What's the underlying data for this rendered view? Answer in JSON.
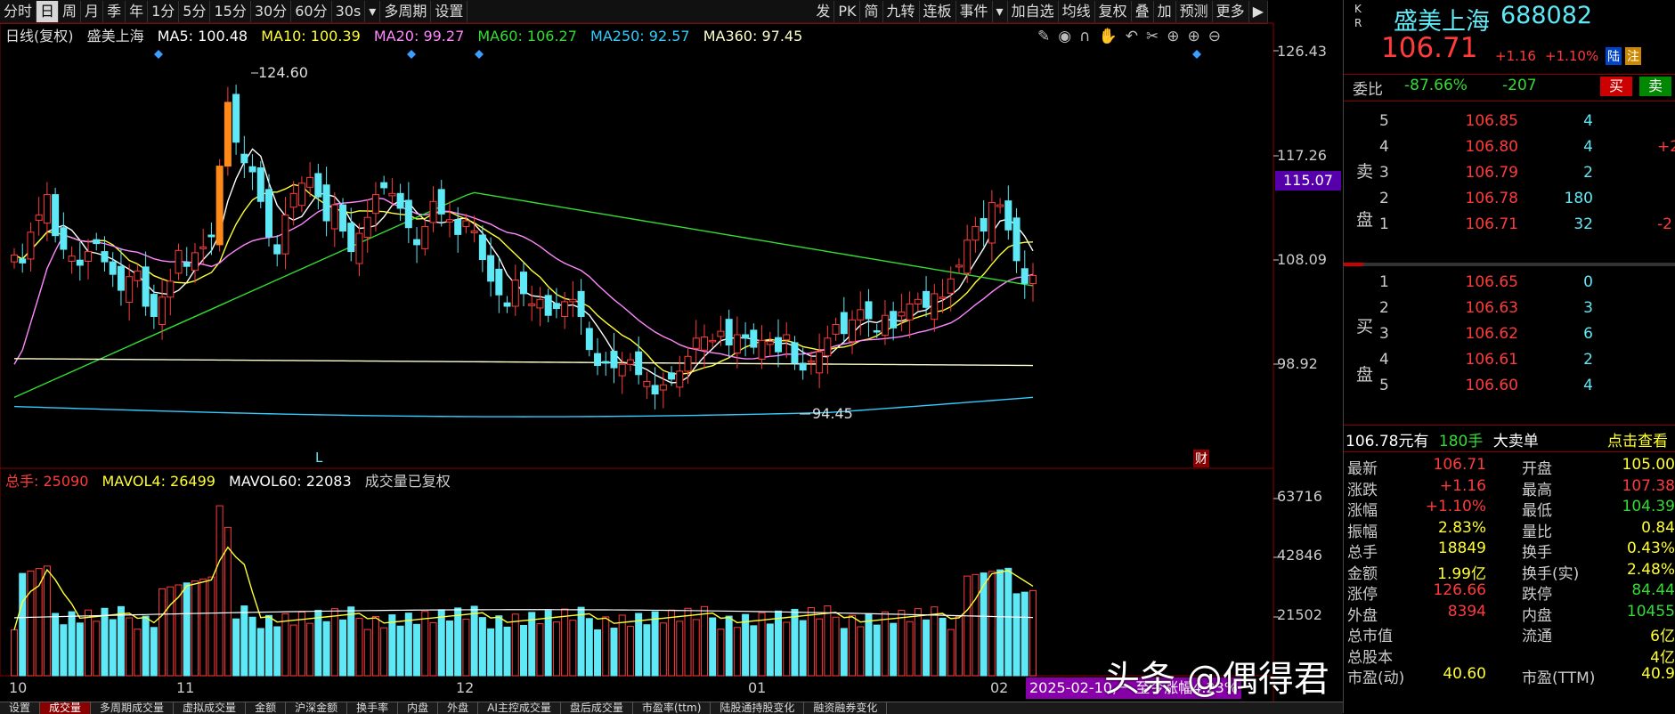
{
  "toolbar": {
    "left_items": [
      "分时",
      "日",
      "周",
      "月",
      "季",
      "年",
      "1分",
      "5分",
      "15分",
      "30分",
      "60分",
      "30s",
      "▾",
      "多周期",
      "设置"
    ],
    "active": "日",
    "right_items": [
      "发",
      "PK",
      "简",
      "九转",
      "连板",
      "事件",
      "▾",
      "加自选",
      "均线",
      "复权",
      "叠",
      "加",
      "预测",
      "更多",
      "▶"
    ]
  },
  "indicators": {
    "period": "日线(复权)",
    "stock": "盛美上海",
    "ma5": "MA5: 100.48",
    "ma10": "MA10: 100.39",
    "ma20": "MA20: 99.27",
    "ma60": "MA60: 106.27",
    "ma250": "MA250: 92.57",
    "ma360": "MA360: 97.45"
  },
  "price_axis": {
    "labels": [
      "126.43",
      "117.26",
      "108.09",
      "98.92"
    ],
    "current": "115.07"
  },
  "annotations": {
    "high": "124.60",
    "low": "94.45",
    "l_mark": "L",
    "cai_mark": "财"
  },
  "volume_indicators": {
    "total": "总手: 25090",
    "mavol4": "MAVOL4: 26499",
    "mavol60": "MAVOL60: 22083",
    "note": "成交量已复权"
  },
  "volume_axis": [
    "63716",
    "42846",
    "21502"
  ],
  "months": [
    "10",
    "11",
    "12",
    "01",
    "02"
  ],
  "range_info": "2025-02-10,一 至今涨幅4.23%",
  "bottom_tabs": [
    "设置",
    "成交量",
    "多周期成交量",
    "虚拟成交量",
    "金额",
    "沪深金额",
    "换手率",
    "内盘",
    "外盘",
    "AI主控成交量",
    "盘后成交量",
    "市盈率(ttm)",
    "陆股通持股变化",
    "融资融券变化"
  ],
  "bottom_active": "成交量",
  "quote": {
    "side_letters": [
      "K",
      "R"
    ],
    "name": "盛美上海",
    "code": "688082",
    "price": "106.71",
    "change": "+1.16",
    "pct": "+1.10%",
    "tags": [
      "陆",
      "注"
    ],
    "weibi_label": "委比",
    "weibi": "-87.66%",
    "weicha": "-207",
    "buy_btn": "买",
    "sell_btn": "卖",
    "sell_label": [
      "卖",
      "盘"
    ],
    "buy_label": [
      "买",
      "盘"
    ],
    "asks": [
      {
        "lvl": "5",
        "price": "106.85",
        "vol": "4",
        "extra": ""
      },
      {
        "lvl": "4",
        "price": "106.80",
        "vol": "4",
        "extra": "+2"
      },
      {
        "lvl": "3",
        "price": "106.79",
        "vol": "2",
        "extra": ""
      },
      {
        "lvl": "2",
        "price": "106.78",
        "vol": "180",
        "extra": ""
      },
      {
        "lvl": "1",
        "price": "106.71",
        "vol": "32",
        "extra": "-2"
      }
    ],
    "bids": [
      {
        "lvl": "1",
        "price": "106.65",
        "vol": "0"
      },
      {
        "lvl": "2",
        "price": "106.63",
        "vol": "3"
      },
      {
        "lvl": "3",
        "price": "106.62",
        "vol": "6"
      },
      {
        "lvl": "4",
        "price": "106.61",
        "vol": "2"
      },
      {
        "lvl": "5",
        "price": "106.60",
        "vol": "4"
      }
    ],
    "bigorder": {
      "a": "106.78元有",
      "b": "180手",
      "c": "大卖单",
      "link": "点击查看"
    },
    "stats": [
      [
        "最新",
        "106.71",
        "开盘",
        "105.00"
      ],
      [
        "涨跌",
        "+1.16",
        "最高",
        "107.38"
      ],
      [
        "涨幅",
        "+1.10%",
        "最低",
        "104.39"
      ],
      [
        "振幅",
        "2.83%",
        "量比",
        "0.84"
      ],
      [
        "总手",
        "18849",
        "换手",
        "0.43%"
      ],
      [
        "金额",
        "1.99亿",
        "换手(实)",
        "2.48%"
      ],
      [
        "涨停",
        "126.66",
        "跌停",
        "84.44"
      ],
      [
        "外盘",
        "8394",
        "内盘",
        "10455"
      ],
      [
        "总市值",
        "",
        "流通",
        "6亿"
      ],
      [
        "总股本",
        "",
        "",
        "4亿"
      ],
      [
        "市盈(动)",
        "40.60",
        "市盈(TTM)",
        "40.9"
      ]
    ]
  },
  "watermark": "头条 @偶得君",
  "colors": {
    "up": "#ff3b3b",
    "down": "#5fe8f5",
    "ma5": "#ffffff",
    "ma10": "#ffff33",
    "ma20": "#ff88ff",
    "ma60": "#33dd33",
    "ma250": "#33ccff",
    "ma360": "#ffffcc"
  }
}
